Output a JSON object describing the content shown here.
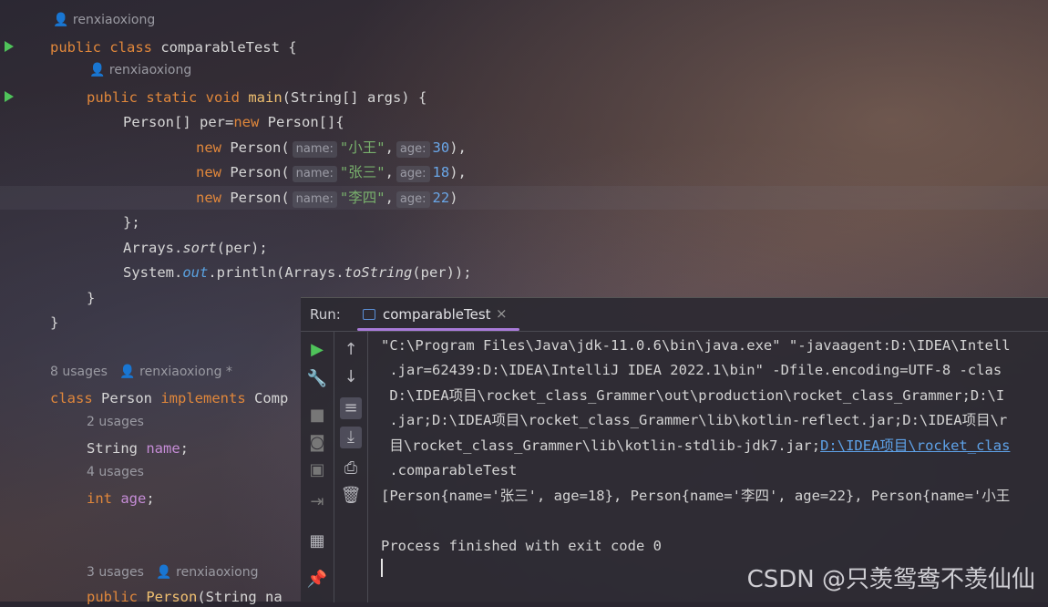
{
  "editor": {
    "author1": "renxiaoxiong",
    "line_class": [
      "public ",
      "class ",
      "comparableTest {"
    ],
    "author2": "renxiaoxiong",
    "line_main": [
      "public ",
      "static ",
      "void ",
      "main",
      "(String[] args) {"
    ],
    "line_arr": [
      "Person[] per=",
      "new ",
      "Person[]{"
    ],
    "persons": [
      {
        "kw": "new ",
        "cls": "Person(",
        "hint_name": "name:",
        "name": "\"小王\"",
        "hint_age": "age:",
        "age": "30",
        "end": "),"
      },
      {
        "kw": "new ",
        "cls": "Person(",
        "hint_name": "name:",
        "name": "\"张三\"",
        "hint_age": "age:",
        "age": "18",
        "end": "),"
      },
      {
        "kw": "new ",
        "cls": "Person(",
        "hint_name": "name:",
        "name": "\"李四\"",
        "hint_age": "age:",
        "age": "22",
        "end": ")"
      }
    ],
    "line_close_arr": "};",
    "line_sort": [
      "Arrays.",
      "sort",
      "(per);"
    ],
    "line_println": [
      "System.",
      "out",
      ".println(Arrays.",
      "toString",
      "(per));"
    ],
    "close1": "}",
    "close2": "}",
    "usages1": "8 usages",
    "author3": "renxiaoxiong *",
    "line_person": [
      "class ",
      "Person ",
      "implements ",
      "Comp"
    ],
    "usages2": "2 usages",
    "line_name": [
      "String ",
      "name",
      ";"
    ],
    "usages3": "4 usages",
    "line_age": [
      "int ",
      "age",
      ";"
    ],
    "usages4": "3 usages",
    "author4": "renxiaoxiong",
    "line_ctor": [
      "public ",
      "Person",
      "(String na"
    ]
  },
  "run": {
    "label": "Run:",
    "tab": "comparableTest",
    "tab_close": "×",
    "console": [
      "\"C:\\Program Files\\Java\\jdk-11.0.6\\bin\\java.exe\" \"-javaagent:D:\\IDEA\\Intell",
      " .jar=62439:D:\\IDEA\\IntelliJ IDEA 2022.1\\bin\" -Dfile.encoding=UTF-8 -clas",
      " D:\\IDEA项目\\rocket_class_Grammer\\out\\production\\rocket_class_Grammer;D:\\I",
      " .jar;D:\\IDEA项目\\rocket_class_Grammer\\lib\\kotlin-reflect.jar;D:\\IDEA项目\\r",
      " 目\\rocket_class_Grammer\\lib\\kotlin-stdlib-jdk7.jar;",
      " .comparableTest",
      "[Person{name='张三', age=18}, Person{name='李四', age=22}, Person{name='小王",
      "",
      "Process finished with exit code 0"
    ],
    "console_link": "D:\\IDEA项目\\rocket_clas"
  },
  "watermark": "CSDN @只羡鸳鸯不羡仙仙"
}
